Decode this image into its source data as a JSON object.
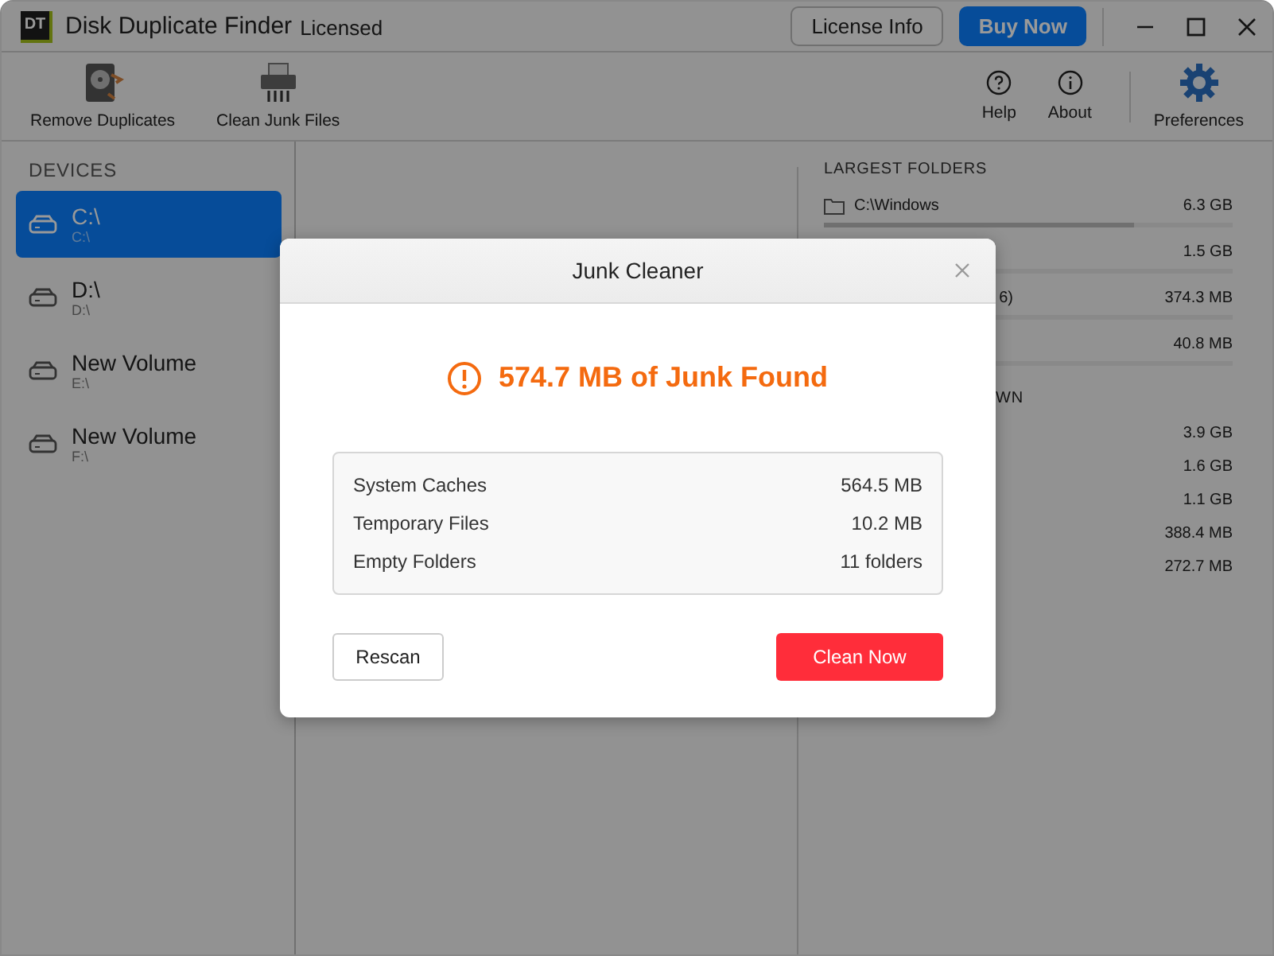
{
  "window": {
    "logo": "DT",
    "title": "Disk Duplicate Finder",
    "license_status": "Licensed"
  },
  "header_buttons": [
    {
      "label": "License Info",
      "kind": "outline"
    },
    {
      "label": "Buy Now",
      "kind": "primary"
    }
  ],
  "toolbar": {
    "left": [
      {
        "label": "Remove Duplicates",
        "kind": "duplicates"
      },
      {
        "label": "Clean Junk Files",
        "kind": "shredder"
      }
    ],
    "right": [
      {
        "label": "Help",
        "kind": "help"
      },
      {
        "label": "About",
        "kind": "about"
      },
      {
        "label": "Preferences",
        "kind": "preferences"
      }
    ]
  },
  "sidebar": {
    "heading": "DEVICES",
    "items": [
      {
        "name": "C:\\",
        "path": "C:\\",
        "selected": true
      },
      {
        "name": "D:\\",
        "path": "D:\\",
        "selected": false
      },
      {
        "name": "New Volume",
        "path": "E:\\",
        "selected": false
      },
      {
        "name": "New Volume",
        "path": "F:\\",
        "selected": false
      }
    ]
  },
  "largest_folders": {
    "heading": "LARGEST FOLDERS",
    "rows": [
      {
        "name": "C:\\Windows",
        "size": "6.3 GB",
        "level": 0.76
      },
      {
        "size": "1.5 GB"
      },
      {
        "name": "6)",
        "size": "374.3 MB"
      },
      {
        "size": "40.8 MB"
      }
    ]
  },
  "breakdown": {
    "heading": "WN",
    "rows": [
      {
        "size": "3.9 GB"
      },
      {
        "size": "1.6 GB"
      },
      {
        "size": "1.1 GB"
      },
      {
        "size": "388.4 MB"
      },
      {
        "size": "272.7 MB"
      }
    ]
  },
  "dialog": {
    "title": "Junk Cleaner",
    "headline": "574.7 MB of Junk Found",
    "items": [
      {
        "label": "System Caches",
        "value": "564.5 MB"
      },
      {
        "label": "Temporary Files",
        "value": "10.2 MB"
      },
      {
        "label": "Empty Folders",
        "value": "11 folders"
      }
    ],
    "buttons": [
      {
        "label": "Rescan",
        "kind": "secondary"
      },
      {
        "label": "Clean Now",
        "kind": "danger"
      }
    ]
  }
}
